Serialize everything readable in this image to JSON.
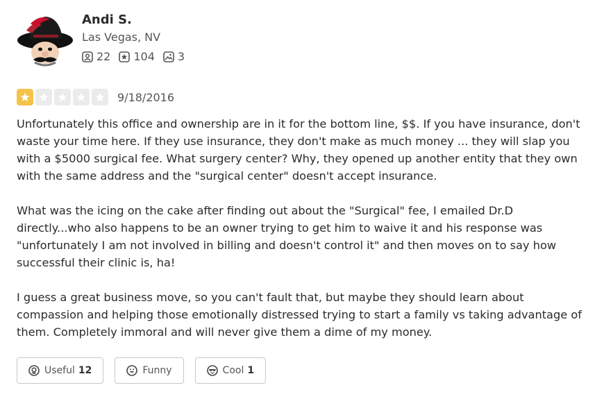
{
  "user": {
    "name": "Andi S.",
    "location": "Las Vegas, NV",
    "stats": {
      "friends": "22",
      "reviews": "104",
      "photos": "3"
    }
  },
  "review": {
    "rating": 1,
    "rating_max": 5,
    "date": "9/18/2016",
    "paragraphs": [
      "Unfortunately this office and ownership are in it for the bottom line, $$. If you have insurance, don't waste your time here. If they use insurance, they don't make as much money ... they will slap you with a $5000 surgical fee. What surgery center? Why, they opened up another entity that they own with the same address and the \"surgical center\" doesn't accept insurance.",
      "What was the icing on the cake after finding out about the \"Surgical\" fee, I emailed Dr.D directly...who also happens to be an owner trying to get him to waive it and his response was \"unfortunately I am not involved in billing and doesn't control it\" and then moves on to say how successful their clinic is, ha!",
      "I guess a great business move, so you can't fault that, but maybe they should learn about compassion and helping those emotionally distressed trying to start a family vs taking advantage of them. Completely immoral and will never give them a dime of my money."
    ]
  },
  "actions": {
    "useful": {
      "label": "Useful",
      "count": "12"
    },
    "funny": {
      "label": "Funny",
      "count": ""
    },
    "cool": {
      "label": "Cool",
      "count": "1"
    }
  },
  "colors": {
    "star_filled": "#f5c34b",
    "star_empty": "#ebebeb"
  }
}
